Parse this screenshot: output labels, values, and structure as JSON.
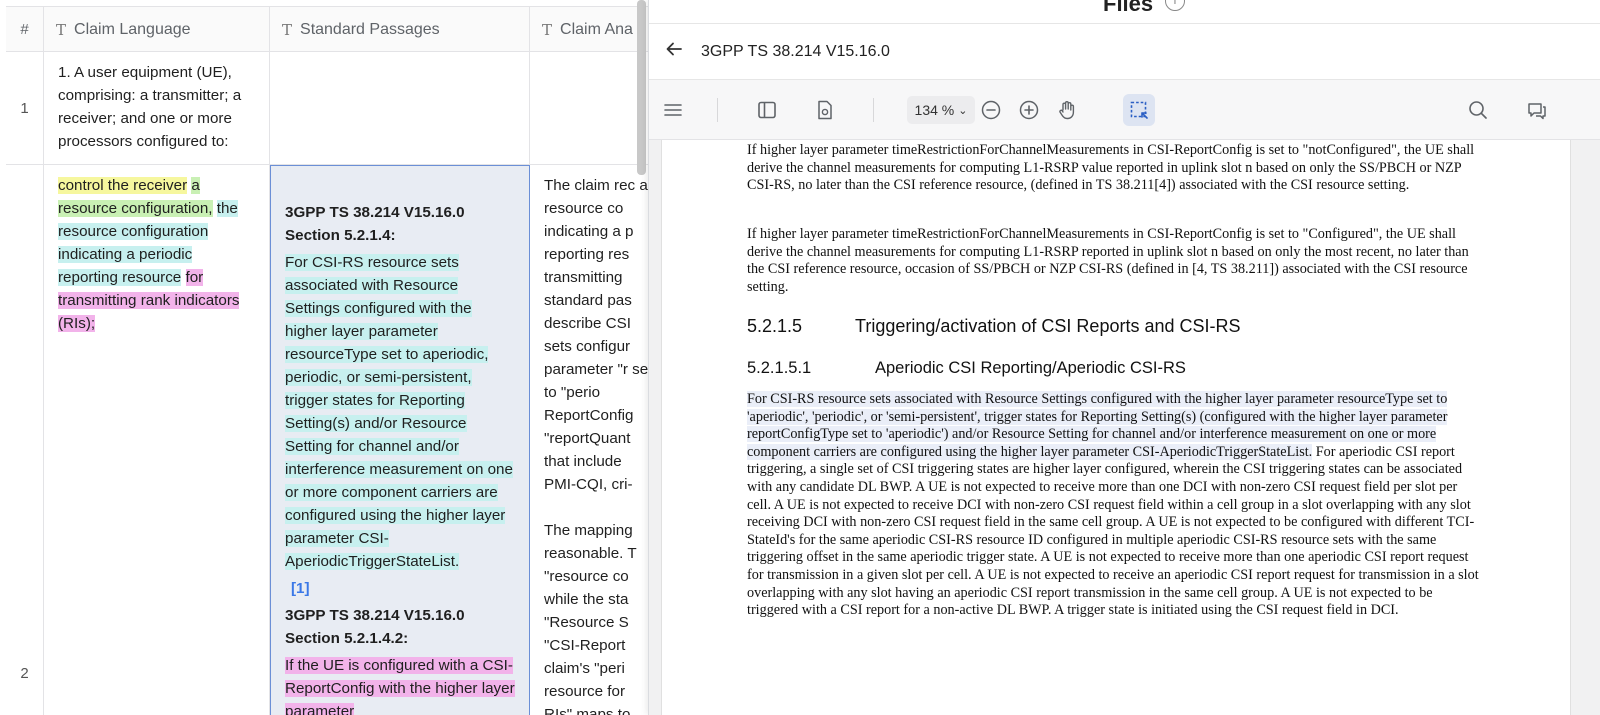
{
  "table": {
    "columns": [
      {
        "label": "#"
      },
      {
        "label": "Claim Language"
      },
      {
        "label": "Standard Passages"
      },
      {
        "label": "Claim Ana"
      }
    ],
    "rows": [
      {
        "num": "1",
        "claim": "1. A user equipment (UE), comprising: a transmitter; a receiver; and one or more processors configured to:",
        "standard": "",
        "analysis": ""
      },
      {
        "num": "2",
        "claim_parts": [
          {
            "text": "control the receiver",
            "hl": "y"
          },
          {
            "text": " ",
            "hl": ""
          },
          {
            "text": "a resource configuration,",
            "hl": "g"
          },
          {
            "text": " ",
            "hl": ""
          },
          {
            "text": "the resource configuration indicating a periodic reporting resource",
            "hl": "c"
          },
          {
            "text": " ",
            "hl": ""
          },
          {
            "text": "for transmitting rank indicators (RIs);",
            "hl": "m"
          }
        ],
        "standard": {
          "title1": "3GPP TS 38.214 V15.16.0 Section 5.2.1.4:",
          "passage1": "For CSI-RS resource sets associated with Resource Settings configured with the higher layer parameter resourceType set to aperiodic, periodic, or semi-persistent, trigger states for Reporting Setting(s) and/or Resource Setting for channel and/or interference measurement on one or more component carriers are configured using the higher layer parameter CSI-AperiodicTriggerStateList.",
          "cite": "[1]",
          "title2": "3GPP TS 38.214 V15.16.0 Section 5.2.1.4.2:",
          "passage2": "If the UE is configured with a CSI-ReportConfig with the higher layer parameter"
        },
        "analysis": {
          "p1": "The claim rec a resource co indicating a p reporting res transmitting standard pas describe CSI sets configur parameter \"r set to \"perio ReportConfig \"reportQuant that include PMI-CQI, cri-",
          "p2": "The mapping reasonable. T \"resource co while the sta \"Resource S \"CSI-Report claim's \"peri resource for RIs\" maps to"
        }
      }
    ]
  },
  "panel": {
    "header_title": "Files",
    "doc_title": "3GPP TS 38.214 V15.16.0",
    "zoom": "134 %",
    "icons": [
      "menu-icon",
      "sidebar-icon",
      "document-settings-icon",
      "zoom-out-icon",
      "zoom-in-icon",
      "hand-icon",
      "area-select-icon",
      "search-icon",
      "comments-icon"
    ],
    "doc": {
      "para1": "If higher layer parameter timeRestrictionForChannelMeasurements in CSI-ReportConfig is set to \"notConfigured\", the UE shall derive the channel measurements for computing L1-RSRP value reported in uplink slot n based on only the SS/PBCH or NZP CSI-RS, no later than the CSI reference resource, (defined in TS 38.211[4]) associated with the CSI resource setting.",
      "para2": "If higher layer parameter timeRestrictionForChannelMeasurements in CSI-ReportConfig is set to \"Configured\", the UE shall derive the channel measurements for computing L1-RSRP reported in uplink slot n based on only the most recent, no later than the CSI reference resource, occasion of SS/PBCH or NZP CSI-RS (defined in [4, TS 38.211]) associated with the CSI resource setting.",
      "sec1_num": "5.2.1.5",
      "sec1_title": "Triggering/activation of CSI Reports and CSI-RS",
      "sec2_num": "5.2.1.5.1",
      "sec2_title": "Aperiodic CSI Reporting/Aperiodic CSI-RS",
      "para3_hl": "For CSI-RS resource sets associated with Resource Settings configured with the higher layer parameter resourceType set to 'aperiodic', 'periodic', or 'semi-persistent', trigger states for Reporting Setting(s) (configured with the higher layer parameter reportConfigType set to 'aperiodic') and/or Resource Setting for channel and/or interference measurement on one or more component carriers are configured using the higher layer parameter CSI-AperiodicTriggerStateList.",
      "para3_rest": "For aperiodic CSI report triggering, a single set of CSI triggering states are higher layer configured, wherein the CSI triggering states can be associated with any candidate DL BWP. A UE is not expected to receive more than one DCI with non-zero CSI request field per slot per cell. A UE is not expected to receive DCI with non-zero CSI request field within a cell group in a slot overlapping with any slot receiving DCI with non-zero CSI request field in the same cell group. A UE is not expected to be configured with different TCI-StateId's for the same aperiodic CSI-RS resource ID configured in multiple aperiodic CSI-RS resource sets with the same triggering offset in the same aperiodic trigger state. A UE is not expected to receive more than one aperiodic CSI report request for transmission in a given slot per cell. A UE is not expected to receive an aperiodic CSI report request for transmission in a slot overlapping with any slot having an aperiodic CSI report transmission in the same cell group. A UE is not expected to be triggered with a CSI report for a non-active DL BWP. A trigger state is initiated using the CSI request field in DCI."
    }
  }
}
